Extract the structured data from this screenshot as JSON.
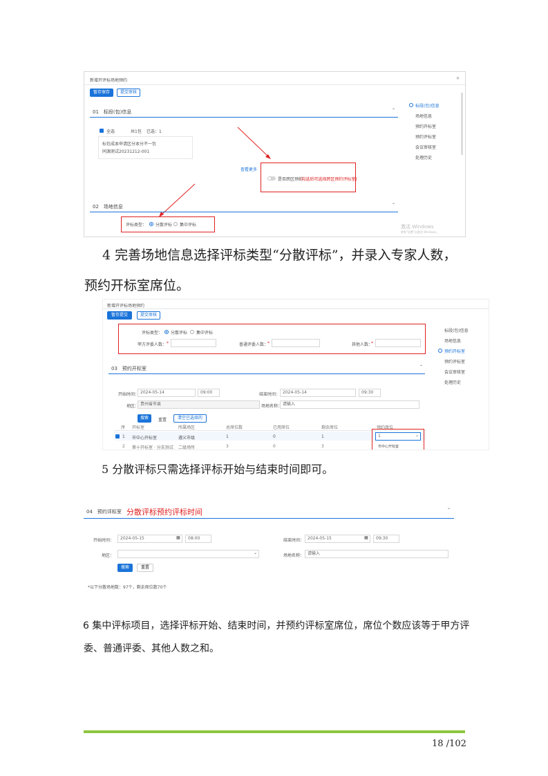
{
  "shot1": {
    "dialog_title": "新增开评标场地预约",
    "btn_save": "暂存保存",
    "btn_submit": "提交审核",
    "section1_title": "01　标段(包)信息",
    "select_all": "全选",
    "total": "共1包",
    "selected": "已选：1",
    "item_line1": "标包成本申请区分本分不一包",
    "item_line2": "同源测试20231212-001",
    "view_more": "查看更多",
    "toggle_label": "是否跨区预约",
    "toggle_note": "(勾选后可选择跨区预约评标室)",
    "section2_title": "02　场地信息",
    "eval_type_label": "评标类型：",
    "opt_dispersed": "分散评标",
    "opt_centralized": "集中评标",
    "nav": [
      "标段(包)信息",
      "场地信息",
      "预约开标室",
      "预约评标室",
      "会议审核室",
      "处理历史"
    ],
    "watermark_1": "激活 Windows",
    "watermark_2": "转到\"设置\"以激活 Windows。"
  },
  "para4": {
    "line1": "4 完善场地信息选择评标类型“分散评标”，并录入专家人数，",
    "line2": "预约开标室席位。"
  },
  "shot2": {
    "dialog_title": "新增开评标场地预约",
    "btn_save": "暂存提交",
    "btn_submit": "提交审核",
    "eval_type_label": "评标类型：",
    "opt_dispersed": "分散评标",
    "opt_centralized": "集中评标",
    "field_a": "甲方评委人数：",
    "field_b": "普通评委人数：",
    "field_c": "其他人数：",
    "required_mark": "*",
    "section_title": "03　预约开标室",
    "start_label": "开始时间：",
    "start_date": "2024-05-14",
    "start_time": "09:00",
    "end_label": "结束时间：",
    "end_date": "2024-05-14",
    "end_time": "09:30",
    "area_label": "地区：",
    "area_value": "贵州省市县",
    "venue_label": "场地名称：",
    "venue_placeholder": "请输入",
    "btn_search": "搜索",
    "btn_reset": "重置",
    "btn_clear": "清空已选择的",
    "headers": [
      "序",
      "开标室",
      "所属场区",
      "总席位数",
      "已用席位",
      "剩余席位",
      "预约席位"
    ],
    "row1": [
      "1",
      "市中心开标室",
      "遵义市级",
      "1",
      "0",
      "1",
      "1"
    ],
    "row2": [
      "2",
      "第十开标室 · 分支测试",
      "二级场所",
      "3",
      "0",
      "3",
      ""
    ],
    "dropdown_option": "市中心开标室",
    "nav": [
      "标段(包)信息",
      "场地信息",
      "预约开标室",
      "预约评标室",
      "会议审核室",
      "处理历史"
    ]
  },
  "para5": {
    "line1": "5 分散评标只需选择评标开始与结束时间即可。"
  },
  "shot3": {
    "section_title": "04　预约评标室",
    "annotation": "分散评标预约评标时间",
    "start_label": "开始时间：",
    "start_date": "2024-05-15",
    "start_time": "08:00",
    "end_label": "结束时间：",
    "end_date": "2024-05-15",
    "end_time": "09:30",
    "area_label": "地区：",
    "venue_label": "场地名称：",
    "venue_placeholder": "请输入",
    "btn_search": "搜索",
    "btn_reset": "重置",
    "note": "*以下分散场地数：97个，剩余席位数70个"
  },
  "para6": {
    "line1": "6 集中评标项目，选择评标开始、结束时间，并预约评标室席位，席位个数应该等于甲方评",
    "line2": "委、普通评委、其他人数之和。"
  },
  "footer": {
    "page": "18 /102",
    "bar_color": "#8dc63f"
  }
}
